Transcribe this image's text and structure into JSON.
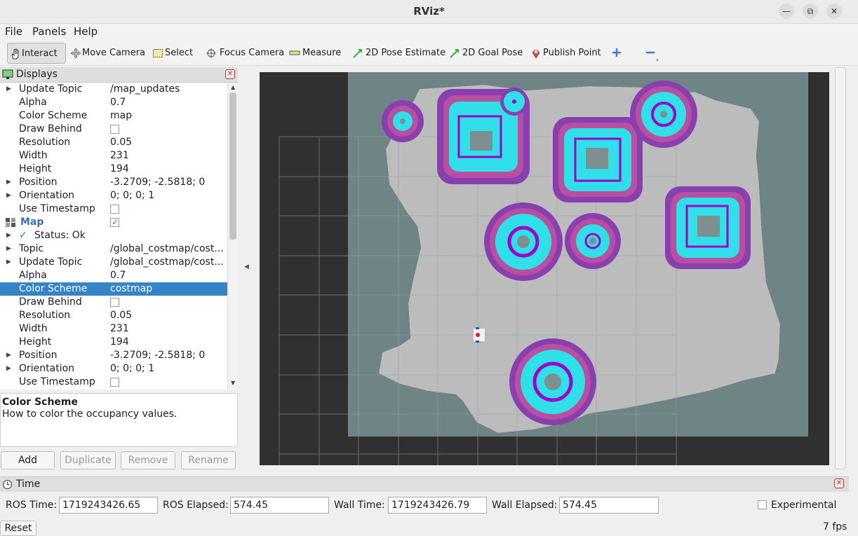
{
  "window": {
    "title": "RViz*"
  },
  "menu": [
    "File",
    "Panels",
    "Help"
  ],
  "toolbar": {
    "interact": "Interact",
    "move_camera": "Move Camera",
    "select": "Select",
    "focus_camera": "Focus Camera",
    "measure": "Measure",
    "pose_estimate": "2D Pose Estimate",
    "goal_pose": "2D Goal Pose",
    "publish_point": "Publish Point"
  },
  "displays": {
    "title": "Displays",
    "rows": [
      {
        "key": "Update Topic",
        "value": "/map_updates",
        "arrow": true
      },
      {
        "key": "Alpha",
        "value": "0.7"
      },
      {
        "key": "Color Scheme",
        "value": "map"
      },
      {
        "key": "Draw Behind",
        "value": "",
        "checkbox": true,
        "checked": false
      },
      {
        "key": "Resolution",
        "value": "0.05"
      },
      {
        "key": "Width",
        "value": "231"
      },
      {
        "key": "Height",
        "value": "194"
      },
      {
        "key": "Position",
        "value": "-3.2709; -2.5818; 0",
        "arrow": true
      },
      {
        "key": "Orientation",
        "value": "0; 0; 0; 1",
        "arrow": true
      },
      {
        "key": "Use Timestamp",
        "value": "",
        "checkbox": true,
        "checked": false
      },
      {
        "key": "Map",
        "value": "",
        "checkbox": true,
        "checked": true,
        "group": true
      },
      {
        "key": "Status: Ok",
        "value": "",
        "arrow": true,
        "status": true
      },
      {
        "key": "Topic",
        "value": "/global_costmap/cost...",
        "arrow": true
      },
      {
        "key": "Update Topic",
        "value": "/global_costmap/cost...",
        "arrow": true
      },
      {
        "key": "Alpha",
        "value": "0.7"
      },
      {
        "key": "Color Scheme",
        "value": "costmap",
        "selected": true
      },
      {
        "key": "Draw Behind",
        "value": "",
        "checkbox": true,
        "checked": false
      },
      {
        "key": "Resolution",
        "value": "0.05"
      },
      {
        "key": "Width",
        "value": "231"
      },
      {
        "key": "Height",
        "value": "194"
      },
      {
        "key": "Position",
        "value": "-3.2709; -2.5818; 0",
        "arrow": true
      },
      {
        "key": "Orientation",
        "value": "0; 0; 0; 1",
        "arrow": true
      },
      {
        "key": "Use Timestamp",
        "value": "",
        "checkbox": true,
        "checked": false
      }
    ],
    "description_title": "Color Scheme",
    "description_text": "How to color the occupancy values.",
    "buttons": {
      "add": "Add",
      "duplicate": "Duplicate",
      "remove": "Remove",
      "rename": "Rename"
    }
  },
  "time": {
    "title": "Time",
    "ros_time_label": "ROS Time:",
    "ros_time": "1719243426.65",
    "ros_elapsed_label": "ROS Elapsed:",
    "ros_elapsed": "574.45",
    "wall_time_label": "Wall Time:",
    "wall_time": "1719243426.79",
    "wall_elapsed_label": "Wall Elapsed:",
    "wall_elapsed": "574.45",
    "experimental_label": "Experimental"
  },
  "status": {
    "reset": "Reset",
    "fps": "7 fps"
  }
}
